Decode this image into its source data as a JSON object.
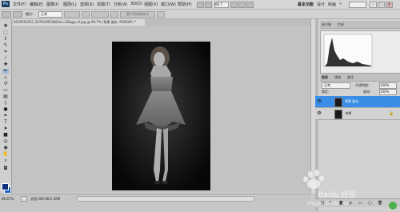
{
  "menubar": {
    "logo": "Ps",
    "items": [
      "文件(F)",
      "编辑(E)",
      "图像(I)",
      "图层(L)",
      "选择(S)",
      "滤镜(T)",
      "分析(A)",
      "3D(D)",
      "视图(V)",
      "窗口(W)",
      "帮助(H)"
    ],
    "zoom": "66.7",
    "workspaces": [
      "基本功能",
      "设计",
      "绘画"
    ],
    "more": "»",
    "window_buttons": [
      "–",
      "□",
      "×"
    ]
  },
  "options": {
    "mode_label": "模式:",
    "mode_value": "正常",
    "opacity_label": "不透明度:",
    "opacity_value": "100%",
    "flow_label": "流量:",
    "flow_value": "100%",
    "blend_button": "基于所有的样式"
  },
  "document": {
    "tab_title": "u=3639593551,3076149536&fm=26&gp=0.jpg @ 66.7% (背景 副本, RGB/8#) *",
    "close": "×"
  },
  "status": {
    "zoom": "66.67%",
    "doc_info": "文档:509.6K/1.36M"
  },
  "panels": {
    "histogram_tab": "直方图",
    "info_tab": "信息",
    "layers_tab": "图层",
    "channels_tab": "通道",
    "paths_tab": "路径",
    "blend_mode": "正常",
    "opacity_label": "不透明度:",
    "opacity_value": "100%",
    "lock_label": "锁定:",
    "fill_label": "填充:",
    "fill_value": "100%",
    "layers": [
      {
        "name": "背景 副本",
        "selected": true
      },
      {
        "name": "背景",
        "selected": false
      }
    ]
  },
  "watermark": {
    "brand": "Baidu 经验",
    "url": "jingyan.baidu.com"
  },
  "colors": {
    "accent": "#3a8ee6",
    "foreground": "#0b2f7a",
    "background_swatch": "#1c5ec4"
  }
}
